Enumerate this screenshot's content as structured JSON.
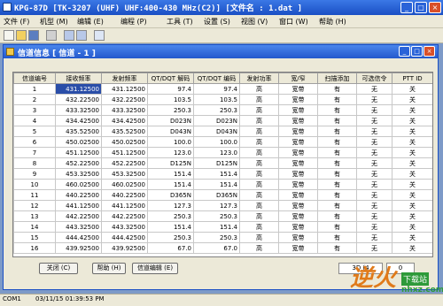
{
  "window": {
    "title": "KPG-87D [TK-3207 (UHF) UHF:400-430 MHz(C2)] [文件名 : 1.dat ]"
  },
  "menu": [
    "文件 (F)",
    "机型 (M)",
    "编辑 (E)",
    "编程 (P)",
    "工具 (T)",
    "设置 (S)",
    "视图 (V)",
    "窗口 (W)",
    "帮助 (H)"
  ],
  "child": {
    "title": "信道信息 [ 信道 - 1 ]"
  },
  "table": {
    "columns": [
      "信道编号",
      "接收频率",
      "发射频率",
      "QT/DQT 解码",
      "QT/DQT 编码",
      "发射功率",
      "宽/窄",
      "扫描添加",
      "可选信令",
      "PTT ID"
    ],
    "rows": [
      [
        "1",
        "431.12500",
        "431.12500",
        "97.4",
        "97.4",
        "高",
        "宽带",
        "有",
        "无",
        "关"
      ],
      [
        "2",
        "432.22500",
        "432.22500",
        "103.5",
        "103.5",
        "高",
        "宽带",
        "有",
        "无",
        "关"
      ],
      [
        "3",
        "433.32500",
        "433.32500",
        "250.3",
        "250.3",
        "高",
        "宽带",
        "有",
        "无",
        "关"
      ],
      [
        "4",
        "434.42500",
        "434.42500",
        "D023N",
        "D023N",
        "高",
        "宽带",
        "有",
        "无",
        "关"
      ],
      [
        "5",
        "435.52500",
        "435.52500",
        "D043N",
        "D043N",
        "高",
        "宽带",
        "有",
        "无",
        "关"
      ],
      [
        "6",
        "450.02500",
        "450.02500",
        "100.0",
        "100.0",
        "高",
        "宽带",
        "有",
        "无",
        "关"
      ],
      [
        "7",
        "451.12500",
        "451.12500",
        "123.0",
        "123.0",
        "高",
        "宽带",
        "有",
        "无",
        "关"
      ],
      [
        "8",
        "452.22500",
        "452.22500",
        "D125N",
        "D125N",
        "高",
        "宽带",
        "有",
        "无",
        "关"
      ],
      [
        "9",
        "453.32500",
        "453.32500",
        "151.4",
        "151.4",
        "高",
        "宽带",
        "有",
        "无",
        "关"
      ],
      [
        "10",
        "460.02500",
        "460.02500",
        "151.4",
        "151.4",
        "高",
        "宽带",
        "有",
        "无",
        "关"
      ],
      [
        "11",
        "440.22500",
        "440.22500",
        "D365N",
        "D365N",
        "高",
        "宽带",
        "有",
        "无",
        "关"
      ],
      [
        "12",
        "441.12500",
        "441.12500",
        "127.3",
        "127.3",
        "高",
        "宽带",
        "有",
        "无",
        "关"
      ],
      [
        "13",
        "442.22500",
        "442.22500",
        "250.3",
        "250.3",
        "高",
        "宽带",
        "有",
        "无",
        "关"
      ],
      [
        "14",
        "443.32500",
        "443.32500",
        "151.4",
        "151.4",
        "高",
        "宽带",
        "有",
        "无",
        "关"
      ],
      [
        "15",
        "444.42500",
        "444.42500",
        "250.3",
        "250.3",
        "高",
        "宽带",
        "有",
        "无",
        "关"
      ],
      [
        "16",
        "439.92500",
        "439.92500",
        "67.0",
        "67.0",
        "高",
        "宽带",
        "有",
        "无",
        "关"
      ]
    ]
  },
  "buttons": {
    "close": "关闭 (C)",
    "help": "帮助 (H)",
    "channel_edit": "信道编辑 (E)"
  },
  "status_boxes": {
    "left": "3D (4",
    "right": "0"
  },
  "statusbar": {
    "port": "COM1",
    "datetime": "03/11/15 01:39:53 PM"
  },
  "watermark": {
    "text1": "逆火",
    "text2": "下载站",
    "text3": "nhxz.com"
  },
  "colors": {
    "title_blue": "#1a4fc4",
    "selection": "#2a4ea8",
    "watermark_orange": "#e07a1a",
    "watermark_green": "#2e9a3a"
  }
}
